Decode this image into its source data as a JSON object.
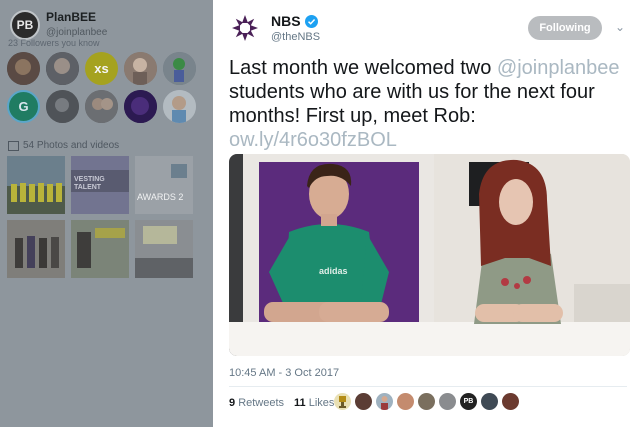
{
  "profile_panel": {
    "name": "PlanBEE",
    "handle": "@joinplanbee",
    "avatar_text": "PB",
    "followers_label": "23 Followers you know",
    "photos_label": "54 Photos and videos",
    "photo_captions": {
      "vesting_talent": "VESTING TALENT",
      "awards": "AWARDS 2"
    }
  },
  "tweet": {
    "author_name": "NBS",
    "author_handle": "@theNBS",
    "follow_label": "Following",
    "text_lines": [
      "Last month we welcomed two ",
      "@joinplanbee",
      " students who are with us for the next four months! First up, meet Rob: ",
      "ow.ly/4r6o30fzBOL"
    ],
    "shirt_text": "adidas",
    "timestamp": "10:45 AM - 3 Oct 2017",
    "retweets_count": "9",
    "retweets_label": "Retweets",
    "likes_count": "11",
    "likes_label": "Likes",
    "liker_pb_text": "PB"
  },
  "colors": {
    "link": "#aab8c2",
    "verified": "#1da1f2",
    "nbs_logo": "#4a2057",
    "overlay": "#8e969d"
  }
}
